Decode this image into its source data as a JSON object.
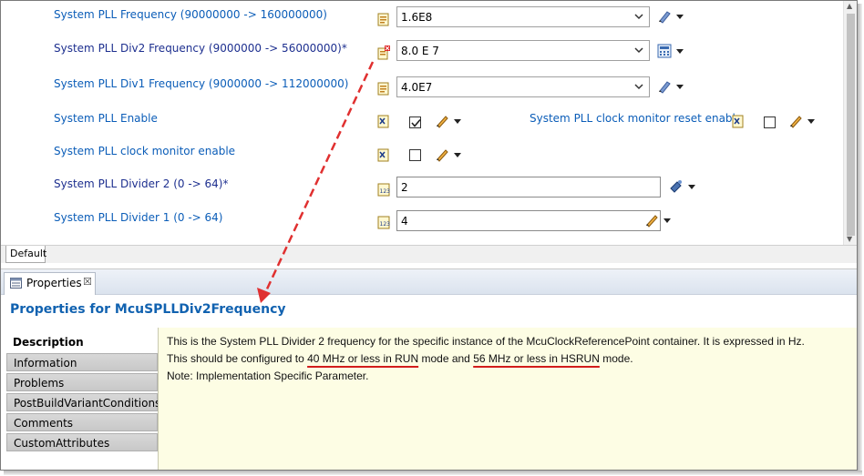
{
  "params": {
    "pll_freq": {
      "label": "System PLL Frequency (90000000 -> 160000000)",
      "value": "1.6E8"
    },
    "pll_div2_freq": {
      "label": "System PLL Div2 Frequency (9000000 -> 56000000)*",
      "value": "8.0 E 7"
    },
    "pll_div1_freq": {
      "label": "System PLL Div1 Frequency (9000000 -> 112000000)",
      "value": "4.0E7"
    },
    "pll_enable": {
      "label": "System PLL Enable",
      "checked": true
    },
    "pll_clock_monitor_reset_enable": {
      "label": "System PLL clock monitor reset enable",
      "checked": false
    },
    "pll_clock_monitor_enable": {
      "label": "System PLL clock monitor enable",
      "checked": false
    },
    "pll_divider2": {
      "label": "System PLL Divider 2 (0 -> 64)*",
      "value": "2"
    },
    "pll_divider1": {
      "label": "System PLL Divider 1 (0 -> 64)",
      "value": "4"
    }
  },
  "editor_tab": {
    "label": "Default"
  },
  "properties": {
    "tab_label": "Properties",
    "close_glyph": "☒",
    "title": "Properties for McuSPLLDiv2Frequency",
    "sections": [
      "Description",
      "Information",
      "Problems",
      "PostBuildVariantConditions",
      "Comments",
      "CustomAttributes"
    ],
    "selected_section": "Description",
    "description": {
      "line1": "This is the System PLL Divider 2 frequency for the specific instance of the McuClockReferencePoint container. It is expressed in Hz.",
      "line2_a": "This should be configured to ",
      "line2_b": "40 MHz or less in RUN",
      "line2_c": " mode and ",
      "line2_d": "56 MHz or less in HSRUN",
      "line2_e": " mode.",
      "line3": "Note: Implementation Specific Parameter."
    }
  },
  "colors": {
    "label_blue": "#0b5db8",
    "modified_label": "#1d2f8f",
    "title_blue": "#1162b0",
    "description_bg": "#fdfde4",
    "annotation_red": "#e03030"
  }
}
